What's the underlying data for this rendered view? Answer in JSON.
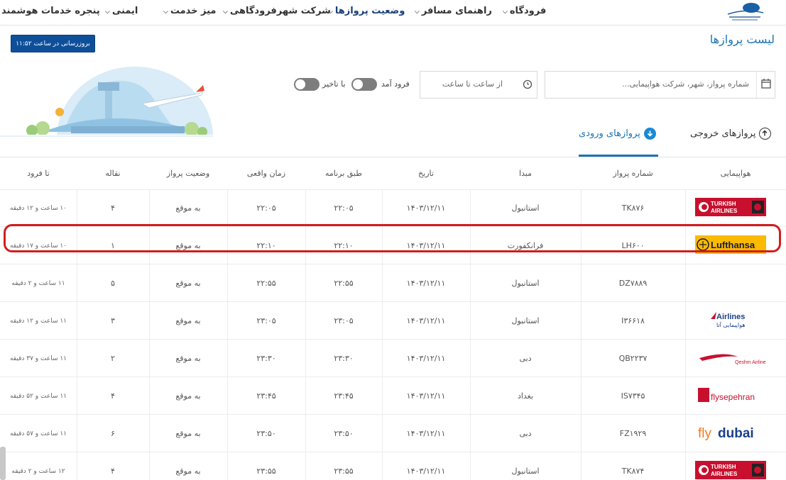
{
  "nav": {
    "items": [
      {
        "label": "فرودگاه",
        "has_menu": true
      },
      {
        "label": "راهنمای مسافر",
        "has_menu": true
      },
      {
        "label": "وضعیت پروازها",
        "has_menu": true,
        "active": true
      },
      {
        "label": "شرکت شهرفرودگاهی",
        "has_menu": true
      },
      {
        "label": "میز خدمت",
        "has_menu": true
      },
      {
        "label": "ایمنی",
        "has_menu": true
      },
      {
        "label": "پنجره خدمات هوشمند",
        "has_menu": false
      }
    ]
  },
  "header": {
    "title": "لیست پروازها",
    "refresh_label": "بروزرسانی در ساعت ۱۱:۵۲"
  },
  "search": {
    "placeholder": "شماره پرواز، شهر، شرکت هواپیمایی...",
    "time_placeholder": "از ساعت تا ساعت",
    "toggle_landed": "فرود آمد",
    "toggle_delayed": "با تاخیر"
  },
  "tabs": {
    "outgoing": "پروازهای خروجی",
    "incoming": "پروازهای ورودی"
  },
  "table": {
    "headers": [
      "هواپیمایی",
      "شماره پرواز",
      "مبدا",
      "تاریخ",
      "طبق برنامه",
      "زمان واقعی",
      "وضعیت پرواز",
      "نقاله",
      "تا فرود"
    ],
    "rows": [
      {
        "airline": "TURKISH AIRLINES",
        "flight": "TK۸۷۶",
        "origin": "استانبول",
        "date": "۱۴۰۳/۱۲/۱۱",
        "scheduled": "۲۲:۰۵",
        "actual": "۲۲:۰۵",
        "status": "به موقع",
        "belt": "۴",
        "eta": "۱۰ ساعت و ۱۲ دقیقه"
      },
      {
        "airline": "Lufthansa",
        "flight": "LH۶۰۰",
        "origin": "فرانکفورت",
        "date": "۱۴۰۳/۱۲/۱۱",
        "scheduled": "۲۲:۱۰",
        "actual": "۲۲:۱۰",
        "status": "به موقع",
        "belt": "۱",
        "eta": "۱۰ ساعت و ۱۷ دقیقه"
      },
      {
        "airline": "",
        "flight": "DZ۷۸۸۹",
        "origin": "استانبول",
        "date": "۱۴۰۳/۱۲/۱۱",
        "scheduled": "۲۲:۵۵",
        "actual": "۲۲:۵۵",
        "status": "به موقع",
        "belt": "۵",
        "eta": "۱۱ ساعت و ۲ دقیقه"
      },
      {
        "airline": "Airlines هواپیمایی آتا",
        "flight": "I۳۶۶۱۸",
        "origin": "استانبول",
        "date": "۱۴۰۳/۱۲/۱۱",
        "scheduled": "۲۳:۰۵",
        "actual": "۲۳:۰۵",
        "status": "به موقع",
        "belt": "۳",
        "eta": "۱۱ ساعت و ۱۲ دقیقه"
      },
      {
        "airline": "Qeshm Airlines",
        "flight": "QB۲۲۳۷",
        "origin": "دبی",
        "date": "۱۴۰۳/۱۲/۱۱",
        "scheduled": "۲۳:۳۰",
        "actual": "۲۳:۳۰",
        "status": "به موقع",
        "belt": "۲",
        "eta": "۱۱ ساعت و ۳۷ دقیقه"
      },
      {
        "airline": "flysepehran",
        "flight": "IS۷۳۴۵",
        "origin": "بغداد",
        "date": "۱۴۰۳/۱۲/۱۱",
        "scheduled": "۲۳:۴۵",
        "actual": "۲۳:۴۵",
        "status": "به موقع",
        "belt": "۴",
        "eta": "۱۱ ساعت و ۵۲ دقیقه"
      },
      {
        "airline": "flydubai",
        "flight": "FZ۱۹۲۹",
        "origin": "دبی",
        "date": "۱۴۰۳/۱۲/۱۱",
        "scheduled": "۲۳:۵۰",
        "actual": "۲۳:۵۰",
        "status": "به موقع",
        "belt": "۶",
        "eta": "۱۱ ساعت و ۵۷ دقیقه"
      },
      {
        "airline": "TURKISH AIRLINES",
        "flight": "TK۸۷۴",
        "origin": "استانبول",
        "date": "۱۴۰۳/۱۲/۱۱",
        "scheduled": "۲۳:۵۵",
        "actual": "۲۳:۵۵",
        "status": "به موقع",
        "belt": "۴",
        "eta": "۱۲ ساعت و ۲ دقیقه"
      }
    ]
  },
  "colors": {
    "accent": "#1b74b5",
    "refresh_button": "#0e4f9a",
    "highlight": "#d41c1c",
    "turkish": "#c8102e",
    "lufthansa": "#f9ba00"
  }
}
